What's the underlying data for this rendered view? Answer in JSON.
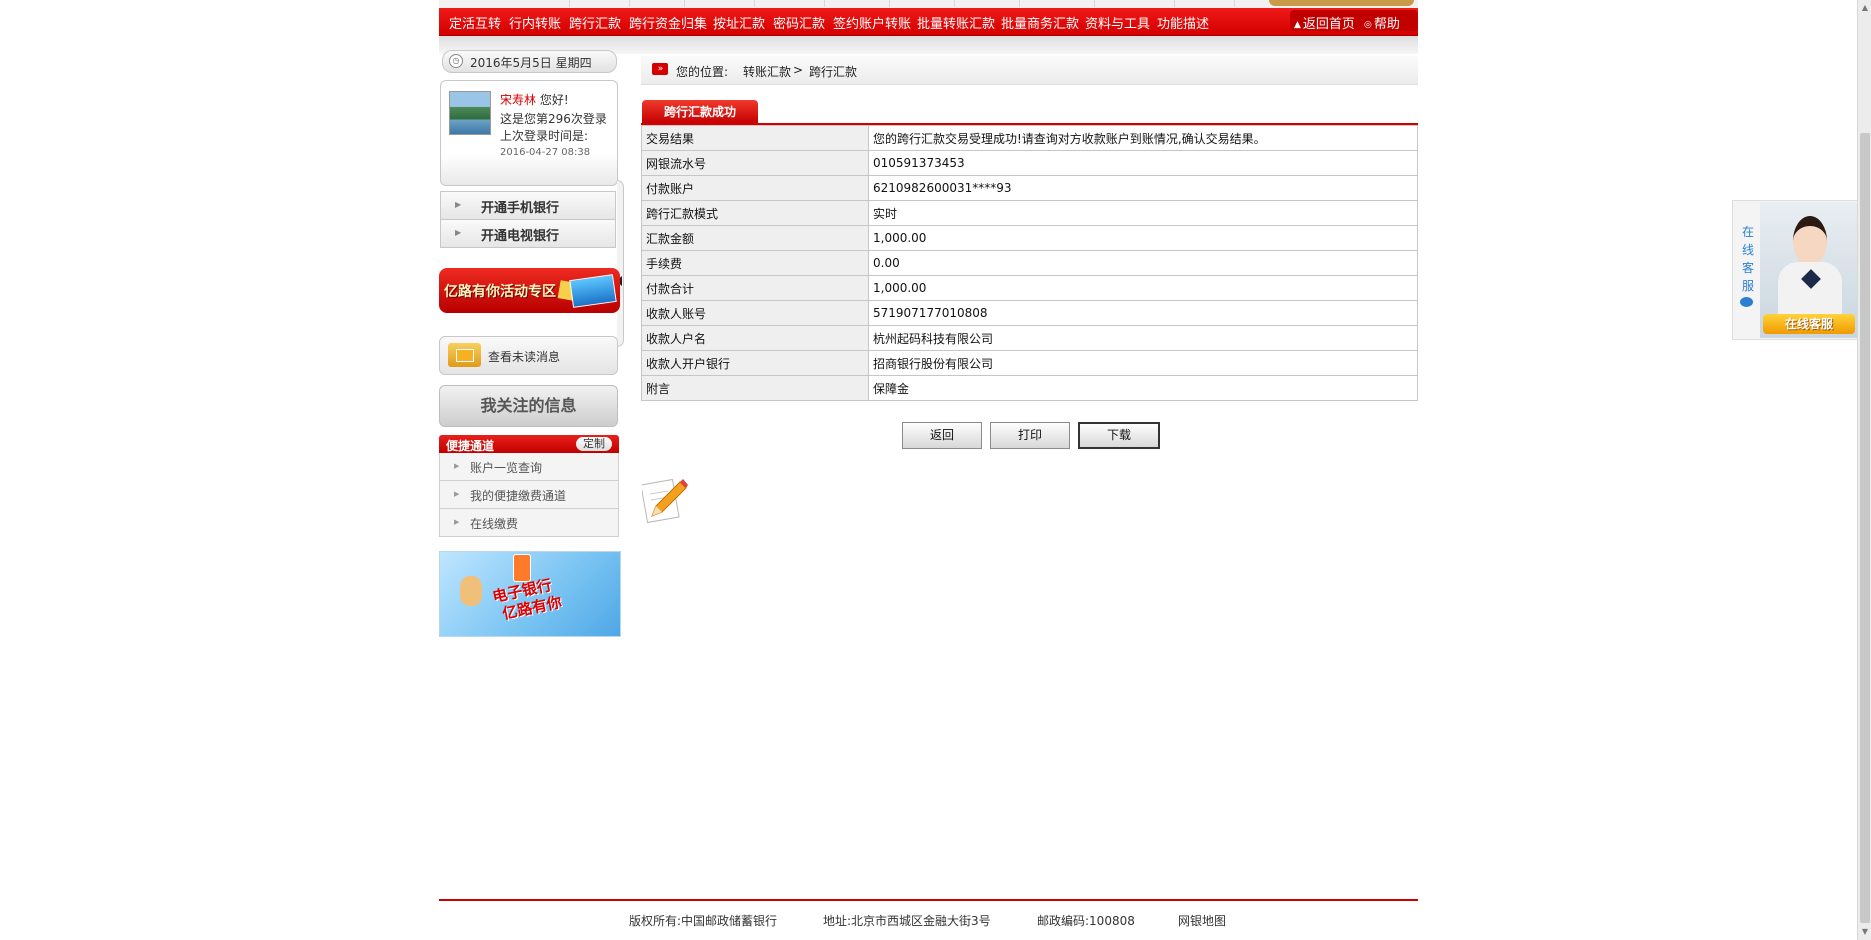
{
  "nav": {
    "items": [
      "定活互转",
      "行内转账",
      "跨行汇款",
      "跨行资金归集",
      "按址汇款",
      "密码汇款",
      "签约账户转账",
      "批量转账汇款",
      "批量商务汇款",
      "资料与工具",
      "功能描述"
    ],
    "home": "返回首页",
    "help": "帮助"
  },
  "sidebar": {
    "date": "2016年5月5日 星期四",
    "user_name": "宋寿林",
    "greeting": "您好!",
    "login_count_text": "这是您第296次登录",
    "last_login_label": "上次登录时间是:",
    "last_login_time": "2016-04-27 08:38",
    "open_mobile": "开通手机银行",
    "open_tv": "开通电视银行",
    "promo_text": "亿路有你活动专区",
    "unread_messages": "查看未读消息",
    "my_focus": "我关注的信息",
    "shortcut_title": "便捷通道",
    "shortcut_custom": "定制",
    "shortcut_items": [
      "账户一览查询",
      "我的便捷缴费通道",
      "在线缴费"
    ],
    "banner_line1": "电子银行",
    "banner_line2": "亿路有你"
  },
  "breadcrumb": {
    "label": "您的位置:",
    "level1": "转账汇款",
    "separator": ">",
    "level2": "跨行汇款"
  },
  "result": {
    "tab_title": "跨行汇款成功",
    "rows": [
      {
        "label": "交易结果",
        "value": "您的跨行汇款交易受理成功!请查询对方收款账户到账情况,确认交易结果。"
      },
      {
        "label": "网银流水号",
        "value": "010591373453"
      },
      {
        "label": "付款账户",
        "value": "6210982600031****93"
      },
      {
        "label": "跨行汇款模式",
        "value": "实时"
      },
      {
        "label": "汇款金额",
        "value": "1,000.00"
      },
      {
        "label": "手续费",
        "value": "0.00"
      },
      {
        "label": "付款合计",
        "value": "1,000.00"
      },
      {
        "label": "收款人账号",
        "value": "571907177010808"
      },
      {
        "label": "收款人户名",
        "value": "杭州起码科技有限公司"
      },
      {
        "label": "收款人开户银行",
        "value": "招商银行股份有限公司"
      },
      {
        "label": "附言",
        "value": "保障金"
      }
    ]
  },
  "buttons": {
    "back": "返回",
    "print": "打印",
    "download": "下载"
  },
  "footer": {
    "copyright": "版权所有:中国邮政储蓄银行",
    "address": "地址:北京市西城区金融大街3号",
    "postcode": "邮政编码:100808",
    "sitemap": "网银地图"
  },
  "service": {
    "vertical": "在线客服",
    "button": "在线客服"
  },
  "colors": {
    "brand_red": "#d40000",
    "link_blue": "#2a7fd1",
    "button_gold": "#f09a00"
  }
}
